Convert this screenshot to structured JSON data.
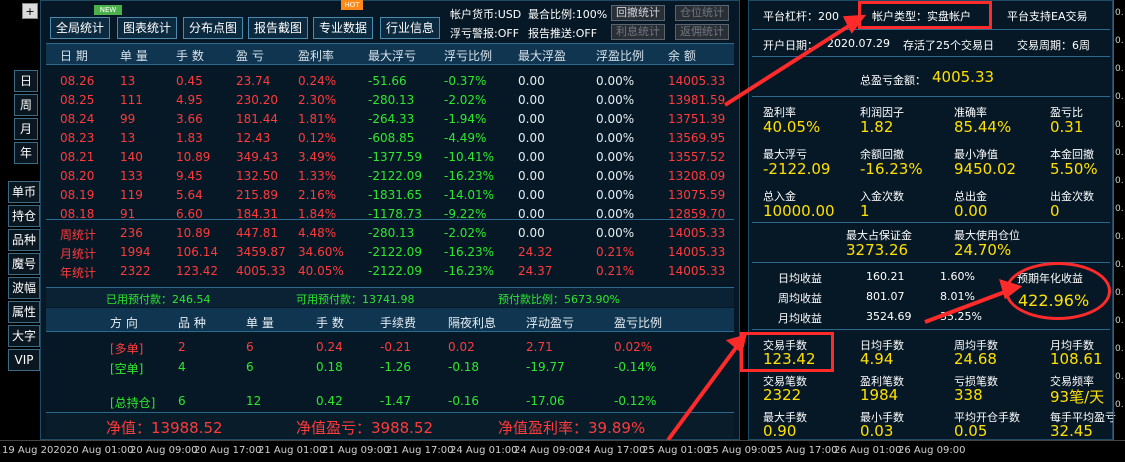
{
  "left_toolbar": {
    "top_button": "+",
    "period_buttons": [
      "日",
      "周",
      "月",
      "年"
    ],
    "side_buttons": [
      "单币",
      "持仓",
      "品种",
      "魔号",
      "波幅",
      "属性",
      "大字",
      "VIP"
    ]
  },
  "top_tabs": [
    {
      "label": "全局统计",
      "badge": "NEW"
    },
    {
      "label": "图表统计"
    },
    {
      "label": "分布点图"
    },
    {
      "label": "报告截图"
    },
    {
      "label": "专业数据",
      "badge": "HOT"
    },
    {
      "label": "行业信息"
    }
  ],
  "status_info": {
    "currency": "帐户货币:USD",
    "exposure": "最合比例:100%",
    "float_alert": "浮亏警报:OFF",
    "report_push": "报告推送:OFF",
    "btn_retrace": "回撤统计",
    "btn_position": "仓位统计",
    "btn_interest": "利息统计",
    "btn_commission": "返佣统计"
  },
  "table": {
    "headers": [
      "日 期",
      "单 量",
      "手 数",
      "盈 亏",
      "盈利率",
      "最大浮亏",
      "浮亏比例",
      "最大浮盈",
      "浮盈比例",
      "余 额"
    ],
    "rows": [
      [
        "08.26",
        "13",
        "0.45",
        "23.74",
        "0.24%",
        "-51.66",
        "-0.37%",
        "0.00",
        "0.00%",
        "14005.33"
      ],
      [
        "08.25",
        "111",
        "4.95",
        "230.20",
        "2.30%",
        "-280.13",
        "-2.02%",
        "0.00",
        "0.00%",
        "13981.59"
      ],
      [
        "08.24",
        "99",
        "3.66",
        "181.44",
        "1.81%",
        "-264.33",
        "-1.94%",
        "0.00",
        "0.00%",
        "13751.39"
      ],
      [
        "08.23",
        "13",
        "1.83",
        "12.43",
        "0.12%",
        "-608.85",
        "-4.49%",
        "0.00",
        "0.00%",
        "13569.95"
      ],
      [
        "08.21",
        "140",
        "10.89",
        "349.43",
        "3.49%",
        "-1377.59",
        "-10.41%",
        "0.00",
        "0.00%",
        "13557.52"
      ],
      [
        "08.20",
        "133",
        "9.45",
        "132.50",
        "1.33%",
        "-2122.09",
        "-16.23%",
        "0.00",
        "0.00%",
        "13208.09"
      ],
      [
        "08.19",
        "119",
        "5.64",
        "215.89",
        "2.16%",
        "-1831.65",
        "-14.01%",
        "0.00",
        "0.00%",
        "13075.59"
      ],
      [
        "08.18",
        "91",
        "6.60",
        "184.31",
        "1.84%",
        "-1178.73",
        "-9.22%",
        "0.00",
        "0.00%",
        "12859.70"
      ]
    ],
    "summary_rows": [
      [
        "周统计",
        "236",
        "10.89",
        "447.81",
        "4.48%",
        "-280.13",
        "-2.02%",
        "0.00",
        "0.00%",
        "14005.33"
      ],
      [
        "月统计",
        "1994",
        "106.14",
        "3459.87",
        "34.60%",
        "-2122.09",
        "-16.23%",
        "24.32",
        "0.21%",
        "14005.33"
      ],
      [
        "年统计",
        "2322",
        "123.42",
        "4005.33",
        "40.05%",
        "-2122.09",
        "-16.23%",
        "24.37",
        "0.21%",
        "14005.33"
      ]
    ]
  },
  "margin_line": {
    "used": "已用预付款：246.54",
    "available": "可用预付款：13741.98",
    "ratio": "预付款比例：5673.90%"
  },
  "position_table": {
    "headers": [
      "方 向",
      "品 种",
      "单 量",
      "手 数",
      "手续费",
      "隔夜利息",
      "浮动盈亏",
      "盈亏比例"
    ],
    "rows": [
      {
        "dir": "[多单]",
        "sym": "2",
        "qty": "6",
        "lots": "0.24",
        "fee": "-0.21",
        "swap": "0.02",
        "pnl": "2.71",
        "ratio": "0.02%",
        "color": "#ff3b3b"
      },
      {
        "dir": "[空单]",
        "sym": "4",
        "qty": "6",
        "lots": "0.18",
        "fee": "-1.26",
        "swap": "-0.18",
        "pnl": "-19.77",
        "ratio": "-0.14%",
        "color": "#2ee82e"
      },
      {
        "dir": "[总持仓]",
        "sym": "6",
        "qty": "12",
        "lots": "0.42",
        "fee": "-1.47",
        "swap": "-0.16",
        "pnl": "-17.06",
        "ratio": "-0.12%",
        "color": "#2ee82e"
      }
    ]
  },
  "bottom_line": {
    "net_value": "净值：13988.52",
    "net_pnl": "净值盈亏：3988.52",
    "net_rate": "净值盈利率：39.89%"
  },
  "right_panel": {
    "leverage": "平台杠杆：200",
    "account_type": "帐户类型：实盘帐户",
    "ea_support": "平台支持EA交易",
    "open_date_label": "开户日期：",
    "open_date": "2020.07.29",
    "trading_days": "存活了25个交易日",
    "period": "交易周期：6周",
    "total_pnl_label": "总盈亏金额：",
    "total_pnl": "4005.33",
    "grid": [
      [
        {
          "l": "盈利率",
          "v": "40.05%"
        },
        {
          "l": "利润因子",
          "v": "1.82"
        },
        {
          "l": "准确率",
          "v": "85.44%"
        },
        {
          "l": "盈亏比",
          "v": "0.31"
        }
      ],
      [
        {
          "l": "最大浮亏",
          "v": "-2122.09"
        },
        {
          "l": "余额回撤",
          "v": "-16.23%"
        },
        {
          "l": "最小净值",
          "v": "9450.02"
        },
        {
          "l": "本金回撤",
          "v": "5.50%"
        }
      ],
      [
        {
          "l": "总入金",
          "v": "10000.00"
        },
        {
          "l": "入金次数",
          "v": "1"
        },
        {
          "l": "总出金",
          "v": "0.00"
        },
        {
          "l": "出金次数",
          "v": "0"
        }
      ]
    ],
    "max_margin_label": "最大占保证金",
    "max_margin": "3273.26",
    "max_position_label": "最大使用仓位",
    "max_position": "24.70%",
    "income": [
      {
        "l": "日均收益",
        "v": "160.21",
        "p": "1.60%"
      },
      {
        "l": "周均收益",
        "v": "801.07",
        "p": "8.01%"
      },
      {
        "l": "月均收益",
        "v": "3524.69",
        "p": "35.25%"
      }
    ],
    "annual_label": "预期年化收益",
    "annual_value": "422.96%",
    "grid2": [
      [
        {
          "l": "交易手数",
          "v": "123.42"
        },
        {
          "l": "日均手数",
          "v": "4.94"
        },
        {
          "l": "周均手数",
          "v": "24.68"
        },
        {
          "l": "月均手数",
          "v": "108.61"
        }
      ],
      [
        {
          "l": "交易笔数",
          "v": "2322"
        },
        {
          "l": "盈利笔数",
          "v": "1984"
        },
        {
          "l": "亏损笔数",
          "v": "338"
        },
        {
          "l": "交易频率",
          "v": "93笔/天"
        }
      ],
      [
        {
          "l": "最大手数",
          "v": "0.90"
        },
        {
          "l": "最小手数",
          "v": "0.03"
        },
        {
          "l": "平均开仓手数",
          "v": "0.05"
        },
        {
          "l": "每手平均盈亏",
          "v": "32.45"
        }
      ]
    ]
  },
  "x_axis": [
    "19 Aug 2020",
    "20 Aug 01:00",
    "20 Aug 09:00",
    "20 Aug 17:00",
    "21 Aug 01:00",
    "21 Aug 09:00",
    "21 Aug 17:00",
    "24 Aug 01:00",
    "24 Aug 09:00",
    "24 Aug 17:00",
    "25 Aug 01:00",
    "25 Aug 09:00",
    "25 Aug 17:00",
    "26 Aug 01:00",
    "26 Aug 09:00"
  ],
  "y_axis": [
    "0.",
    "0.",
    "0.",
    "0.",
    "0.",
    "0.",
    "0.",
    "0.",
    "0.",
    "0.",
    "0.",
    "0.",
    "0.",
    "0.",
    "0."
  ],
  "colors": {
    "accent": "#ffe000",
    "loss": "#ff3b3b",
    "gain": "#2ee82e",
    "annotation": "#ff2a2a"
  }
}
